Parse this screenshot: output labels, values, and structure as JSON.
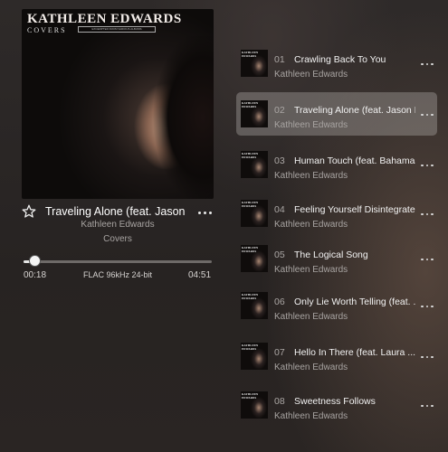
{
  "album_art": {
    "artist_title": "KATHLEEN EDWARDS",
    "subtitle": "COVERS",
    "banner": "EXCERPTED FROM VARIOUS ALBUMS"
  },
  "now_playing": {
    "title": "Traveling Alone (feat. Jason Isbell)",
    "artist": "Kathleen Edwards",
    "album": "Covers",
    "elapsed": "00:18",
    "format": "FLAC 96kHz 24-bit",
    "total": "04:51",
    "progress_fraction": 0.062
  },
  "tracks": [
    {
      "num": "01",
      "title": "Crawling Back To You",
      "artist": "Kathleen Edwards",
      "active": false
    },
    {
      "num": "02",
      "title": "Traveling Alone (feat. Jason Isbell)",
      "artist": "Kathleen Edwards",
      "active": true
    },
    {
      "num": "03",
      "title": "Human Touch (feat. Bahamas)",
      "artist": "Kathleen Edwards",
      "active": false
    },
    {
      "num": "04",
      "title": "Feeling Yourself Disintegrate",
      "artist": "Kathleen Edwards",
      "active": false
    },
    {
      "num": "05",
      "title": "The Logical Song",
      "artist": "Kathleen Edwards",
      "active": false
    },
    {
      "num": "06",
      "title": "Only Lie Worth Telling (feat. ...)",
      "artist": "Kathleen Edwards",
      "active": false
    },
    {
      "num": "07",
      "title": "Hello In There (feat. Laura ...)",
      "artist": "Kathleen Edwards",
      "active": false
    },
    {
      "num": "08",
      "title": "Sweetness Follows",
      "artist": "Kathleen Edwards",
      "active": false
    }
  ],
  "icons": {
    "favorite": "star-outline-icon",
    "more": "ellipsis-icon"
  },
  "colors": {
    "background": "#2b2726",
    "active_row": "#5d5957",
    "progress_fill": "#e6e6e6",
    "progress_track": "#6e6a68"
  }
}
